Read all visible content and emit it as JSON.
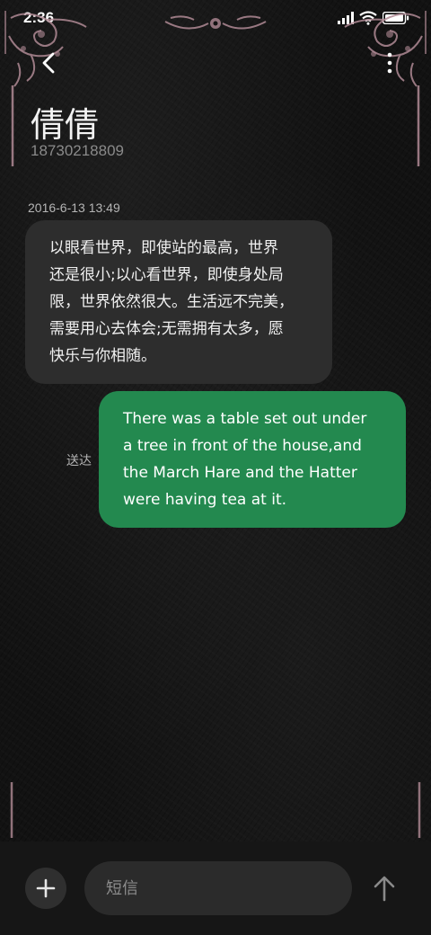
{
  "status_bar": {
    "time": "2:36",
    "icons": [
      "signal-icon",
      "wifi-icon",
      "battery-icon"
    ]
  },
  "header": {
    "back_icon": "chevron-left-icon",
    "more_icon": "more-vertical-icon",
    "contact_name": "倩倩",
    "contact_number": "18730218809"
  },
  "messages": [
    {
      "direction": "incoming",
      "timestamp": "2016-6-13 13:49",
      "lines": [
        "以眼看世界，即使站的最高，世界",
        "还是很小;以心看世界，即使身处局",
        "限，世界依然很大。生活远不完美，",
        "需要用心去体会;无需拥有太多，愿",
        "快乐与你相随。"
      ]
    },
    {
      "direction": "outgoing",
      "status": "送达",
      "lines": [
        "There was a table set out under",
        "a tree in front of the house,and",
        "the March Hare and the Hatter",
        "were having tea at it."
      ]
    }
  ],
  "composer": {
    "add_icon": "plus-icon",
    "placeholder": "短信",
    "send_icon": "arrow-up-icon"
  },
  "colors": {
    "background": "#121212",
    "incoming_bubble": "#2d2d2d",
    "outgoing_bubble": "#23894f",
    "ornament": "#b08a95"
  }
}
